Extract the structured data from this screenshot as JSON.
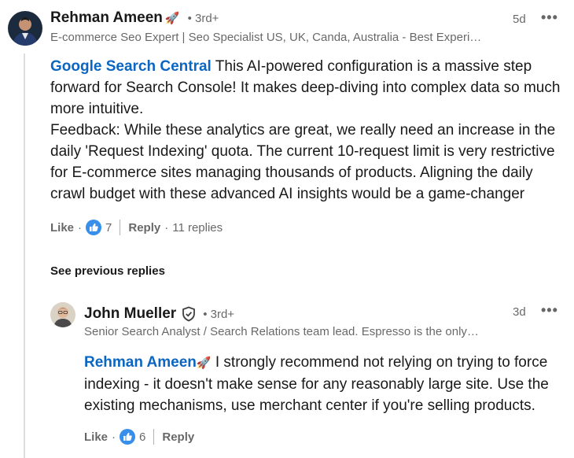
{
  "comment": {
    "author": "Rehman Ameen",
    "author_emoji": "🚀",
    "degree": "• 3rd+",
    "headline": "E-commerce Seo Expert | Seo Specialist US, UK, Canda, Australia - Best Experi…",
    "time": "5d",
    "more": "•••",
    "mention": "Google Search Central",
    "text_line1": " This AI-powered configuration is a massive step forward for Search Console! It makes deep-diving into complex data so much more intuitive.",
    "text_line2": "Feedback: While these analytics are great, we really need an increase in the daily 'Request Indexing' quota. The current 10-request limit is very restrictive for E-commerce sites managing thousands of products. Aligning the daily crawl budget with these advanced AI insights would be a game-changer",
    "like_label": "Like",
    "like_dot": "·",
    "like_count": "7",
    "reply_label": "Reply",
    "reply_dot": "·",
    "replies_count": "11 replies"
  },
  "see_previous": "See previous replies",
  "reply": {
    "author": "John Mueller",
    "degree": "• 3rd+",
    "headline": "Senior Search Analyst / Search Relations team lead. Espresso is the only…",
    "time": "3d",
    "more": "•••",
    "mention": "Rehman Ameen",
    "mention_emoji": "🚀",
    "text": " I strongly recommend not relying on trying to force indexing - it doesn't make sense for any reasonably large site. Use the existing mechanisms, use merchant center if you're selling products.",
    "like_label": "Like",
    "like_dot": "·",
    "like_count": "6",
    "reply_label": "Reply"
  },
  "colors": {
    "link": "#0a66c2",
    "like_icon": "#378fe9"
  }
}
